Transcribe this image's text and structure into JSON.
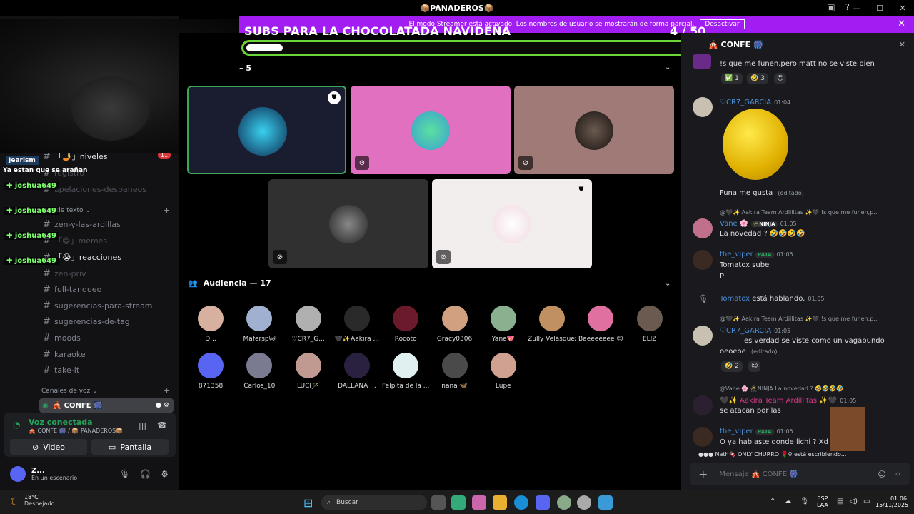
{
  "window": {
    "title": "📦PANADEROS📦",
    "controls": [
      "—",
      "☐",
      "✕"
    ]
  },
  "streamer_banner": {
    "text": "El modo Streamer está activado. Los nombres de usuario se mostrarán de forma parcial.",
    "button": "Desactivar"
  },
  "goal": {
    "title": "SUBS PARA LA CHOCOLATADA NAVIDEÑA",
    "count": "4  / 50",
    "progress": 0.08
  },
  "sidebar": {
    "channels": [
      {
        "name": "「🤳」niveles",
        "badge": "11",
        "style": "white"
      },
      {
        "name": "registro",
        "style": "muted"
      },
      {
        "name": "apelaciones-desbaneos",
        "style": "muted"
      },
      {
        "name": "zen-y-las-ardillas",
        "style": "normal"
      },
      {
        "name": "「😁」memes",
        "style": "muted"
      },
      {
        "name": "「😭」reacciones",
        "style": "white"
      },
      {
        "name": "zen-priv",
        "style": "muted"
      },
      {
        "name": "full-tanqueo",
        "style": "normal"
      },
      {
        "name": "sugerencias-para-stream",
        "style": "normal"
      },
      {
        "name": "sugerencias-de-tag",
        "style": "normal"
      },
      {
        "name": "moods",
        "style": "normal"
      },
      {
        "name": "karaoke",
        "style": "normal"
      },
      {
        "name": "take-it",
        "style": "normal"
      }
    ],
    "text_category": "ales de texto ⌄",
    "voice_category": "Canales de voz ⌄",
    "voice_channel": "🎪 CONFE 🎆"
  },
  "voice_panel": {
    "status": "Voz conectada",
    "location": "🎪 CONFE 🎆 / 📦 PANADEROS📦",
    "video_label": "Video",
    "screen_label": "Pantalla"
  },
  "user_panel": {
    "name": "Z...",
    "status": "En un escenario"
  },
  "overlay_chat": {
    "first_user": "Jearism",
    "first_msg": "Ya estan que se arañan",
    "names": [
      "joshua649",
      "joshua649",
      "joshua649",
      "joshua649"
    ]
  },
  "stage": {
    "speakers_label": "– 5",
    "audience_label": "Audiencia — 17",
    "audience": [
      "D...",
      "Mafersp🐱",
      "♡CR7_G...",
      "🖤✨Aakira ...",
      "Rocoto",
      "Gracy0306",
      "Yane💖",
      "Zully Velásquez",
      "Baeeeeeee 😈",
      "ELIZ",
      "871358",
      "Carlos_10",
      "LUCI🪄",
      "DALLANA ...",
      "Felpita de la ...",
      "nana 🦋",
      "Lupe"
    ]
  },
  "chat": {
    "channel": "🎪 CONFE 🎆",
    "messages": [
      {
        "text": "!s que me funen,pero matt no se viste bien"
      },
      {
        "user": "♡CR7_GARCIA",
        "time": "01:04",
        "text": "Funa me gusta",
        "edited": "(editado)"
      },
      {
        "reply": "@🖤✨ Aakira Team Ardillitas ✨🖤 !s que me funen,p...",
        "user": "Vane 🌸",
        "role": "🥷NINJA",
        "time": "01:05",
        "text": "La novedad ? 🤣🤣🤣🤣"
      },
      {
        "user": "the_viper",
        "role": "P4TA",
        "time": "01:05",
        "text": "Tomatox sube",
        "text2": "P"
      },
      {
        "user": "Tomatox",
        "text": "está hablando.",
        "time": "01:05"
      },
      {
        "reply": "@🖤✨ Aakira Team Ardillitas ✨🖤 !s que me funen,p...",
        "user": "♡CR7_GARCIA",
        "time": "01:05",
        "text": "es verdad se viste como un vagabundo",
        "text2": "oeoeoe",
        "edited": "(editado)"
      },
      {
        "reply": "@Vane 🌸 🥷NINJA La novedad ? 🤣🤣🤣🤣",
        "user": "🖤✨ Aakira Team Ardillitas ✨🖤",
        "time": "01:05",
        "text": "se atacan por las"
      },
      {
        "user": "the_viper",
        "role": "P4TA",
        "time": "01:05",
        "text": "O ya hablaste donde lichi ? Xd"
      }
    ],
    "typing": "Nath🍫 ONLY CHURRO 🌹♀ está escribiendo...",
    "reactions1": [
      "✅ 1",
      "🤣 3"
    ],
    "reactions2": [
      "🤣 2"
    ],
    "input_placeholder": "Mensaje 🎪 CONFE 🎆"
  },
  "taskbar": {
    "weather_temp": "18°C",
    "weather_desc": "Despejado",
    "search": "Buscar",
    "lang": "ESP",
    "lang2": "LAA",
    "time": "01:06",
    "date": "15/11/2025"
  },
  "colors": {
    "accent": "#a21df2",
    "green": "#6ad637",
    "discord": "#5865f2"
  }
}
